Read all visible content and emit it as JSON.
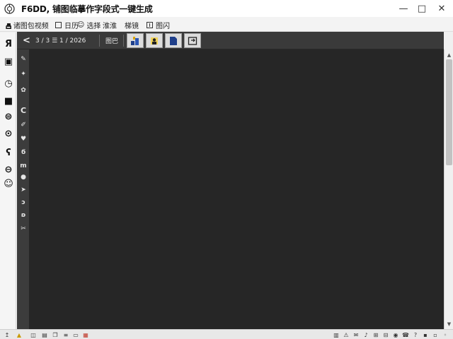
{
  "window": {
    "title": "F6DD, 铺图临摹作字段式一键生成",
    "controls": {
      "minimize": "—",
      "maximize": "□",
      "close": "✕"
    }
  },
  "menubar": {
    "items": [
      {
        "label": "诸图包视频",
        "icon": "image-icon"
      },
      {
        "label": "日历",
        "icon": "calendar-icon"
      },
      {
        "label": "选择",
        "icon": "smile-icon"
      },
      {
        "label": "淮淮",
        "icon": "none"
      },
      {
        "label": "梯镜",
        "icon": "none"
      },
      {
        "label": "图闪",
        "icon": "square-icon"
      }
    ]
  },
  "canvas_toolbar": {
    "back": "<",
    "zoom_label": "3 / 3 ☰ 1 / 2026",
    "mode_label": "图巴"
  },
  "left_toolbar": {
    "icons": [
      "home-icon",
      "text-icon",
      "bus-icon",
      "clock-icon",
      "image-icon",
      "dropper-icon",
      "record-icon",
      "hook-icon",
      "link-icon",
      "smile-icon"
    ]
  },
  "inner_tools": {
    "icons": [
      "pen-icon",
      "eraser-icon",
      "gear-icon",
      "c-icon",
      "brush-icon",
      "heart-icon",
      "drop-icon",
      "m-icon",
      "circle-icon",
      "arrow-icon",
      "spiral-icon",
      "loop-icon",
      "scissors-icon"
    ]
  },
  "status_icons": [
    "scroll-arrow-icon",
    "warning-icon",
    "disk-icon",
    "print-icon",
    "copy-icon",
    "bars-icon",
    "doc-icon",
    "sheet-icon",
    "chart-icon",
    "alert-icon",
    "chat-icon",
    "note-icon",
    "grid-icon",
    "grid-icon",
    "mic-icon",
    "phone-icon",
    "help-icon",
    "tray-icon",
    "tray-icon",
    "tray-icon"
  ],
  "colors": {
    "canvas": "#262626",
    "toolbar_dark": "#3a3a3a",
    "accent_blue": "#1f3f8a"
  }
}
